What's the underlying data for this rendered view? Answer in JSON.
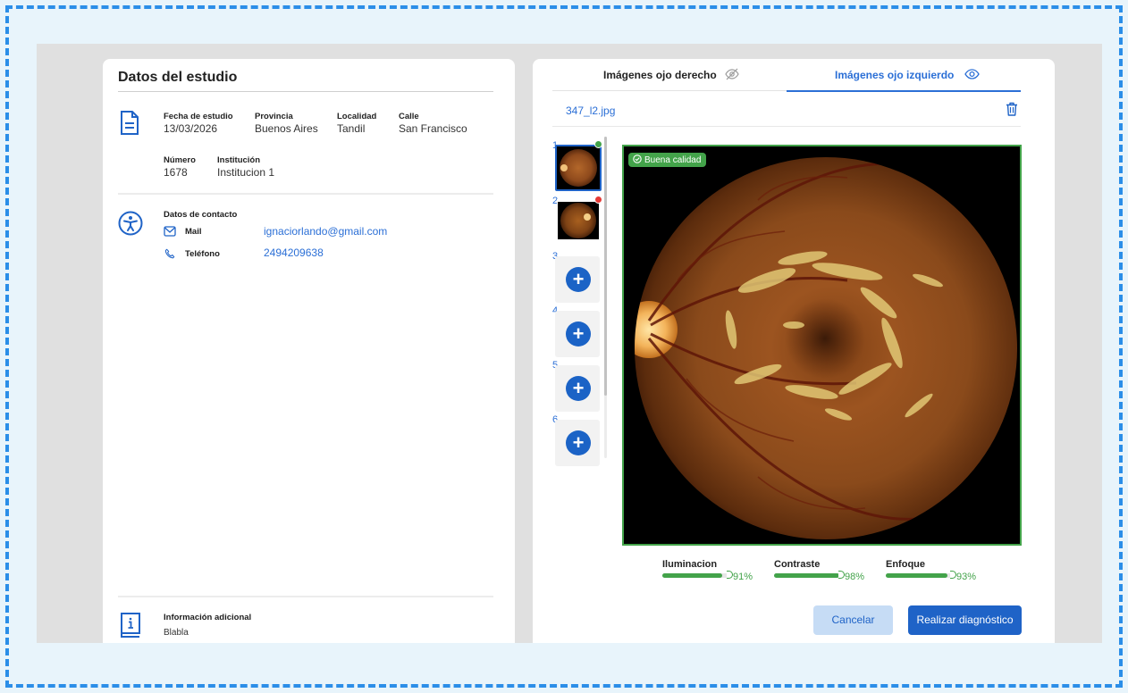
{
  "study": {
    "title": "Datos del estudio",
    "fields": [
      {
        "label": "Fecha de estudio",
        "value": "13/03/2026"
      },
      {
        "label": "Provincia",
        "value": "Buenos Aires"
      },
      {
        "label": "Localidad",
        "value": "Tandil"
      },
      {
        "label": "Calle",
        "value": "San Francisco"
      },
      {
        "label": "Número",
        "value": "1678"
      },
      {
        "label": "Institución",
        "value": "Institucion 1"
      }
    ],
    "contact": {
      "heading": "Datos de contacto",
      "mail_label": "Mail",
      "mail_value": "ignaciorlando@gmail.com",
      "phone_label": "Teléfono",
      "phone_value": "2494209638"
    },
    "extra": {
      "heading": "Información adicional",
      "value": "Blabla"
    }
  },
  "images": {
    "tab_right": "Imágenes ojo derecho",
    "tab_left": "Imágenes ojo izquierdo",
    "active_tab": "left",
    "filename": "347_l2.jpg",
    "thumbnails": [
      {
        "number": "1",
        "filled": true,
        "status": "good",
        "selected": true
      },
      {
        "number": "2",
        "filled": true,
        "status": "bad",
        "selected": false
      },
      {
        "number": "3",
        "filled": false
      },
      {
        "number": "4",
        "filled": false
      },
      {
        "number": "5",
        "filled": false
      },
      {
        "number": "6",
        "filled": false
      }
    ],
    "quality_badge": "Buena calidad",
    "metrics": [
      {
        "label": "Iluminacion",
        "value": "91%",
        "fraction": 0.91
      },
      {
        "label": "Contraste",
        "value": "98%",
        "fraction": 0.98
      },
      {
        "label": "Enfoque",
        "value": "93%",
        "fraction": 0.93
      }
    ],
    "cancel_label": "Cancelar",
    "submit_label": "Realizar diagnóstico"
  },
  "colors": {
    "accent": "#1f63c7",
    "good": "#43a34a",
    "bad": "#e53935"
  }
}
